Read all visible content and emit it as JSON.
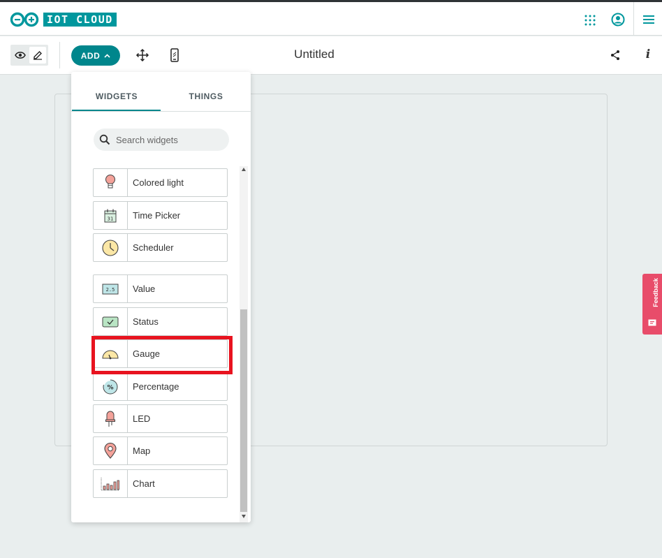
{
  "header": {
    "logo_text": "IOT CLOUD",
    "icons": [
      "arduino-logo-icon",
      "apps-grid-icon",
      "account-icon",
      "menu-icon"
    ]
  },
  "toolbar": {
    "add_label": "ADD",
    "title": "Untitled",
    "info_label": "i",
    "icons": [
      "eye-icon",
      "edit-icon",
      "move-icon",
      "mobile-icon",
      "share-icon",
      "info-icon"
    ]
  },
  "panel": {
    "tabs": [
      {
        "label": "WIDGETS",
        "active": true
      },
      {
        "label": "THINGS",
        "active": false
      }
    ],
    "search": {
      "placeholder": "Search widgets"
    },
    "widgets": [
      {
        "label": "Colored light",
        "icon": "bulb-icon"
      },
      {
        "label": "Time Picker",
        "icon": "calendar-icon",
        "icon_text": "31"
      },
      {
        "label": "Scheduler",
        "icon": "clock-icon"
      },
      {
        "label": "Value",
        "icon": "value-icon",
        "icon_text": "2.5"
      },
      {
        "label": "Status",
        "icon": "status-icon"
      },
      {
        "label": "Gauge",
        "icon": "gauge-icon"
      },
      {
        "label": "Percentage",
        "icon": "percentage-icon",
        "icon_text": "%"
      },
      {
        "label": "LED",
        "icon": "led-icon"
      },
      {
        "label": "Map",
        "icon": "map-pin-icon"
      },
      {
        "label": "Chart",
        "icon": "chart-icon"
      }
    ]
  },
  "feedback": {
    "label": "Feedback"
  },
  "colors": {
    "brand": "#00979d",
    "accent": "#00868c",
    "highlight": "#e8131f",
    "feedback": "#e84c6a"
  }
}
